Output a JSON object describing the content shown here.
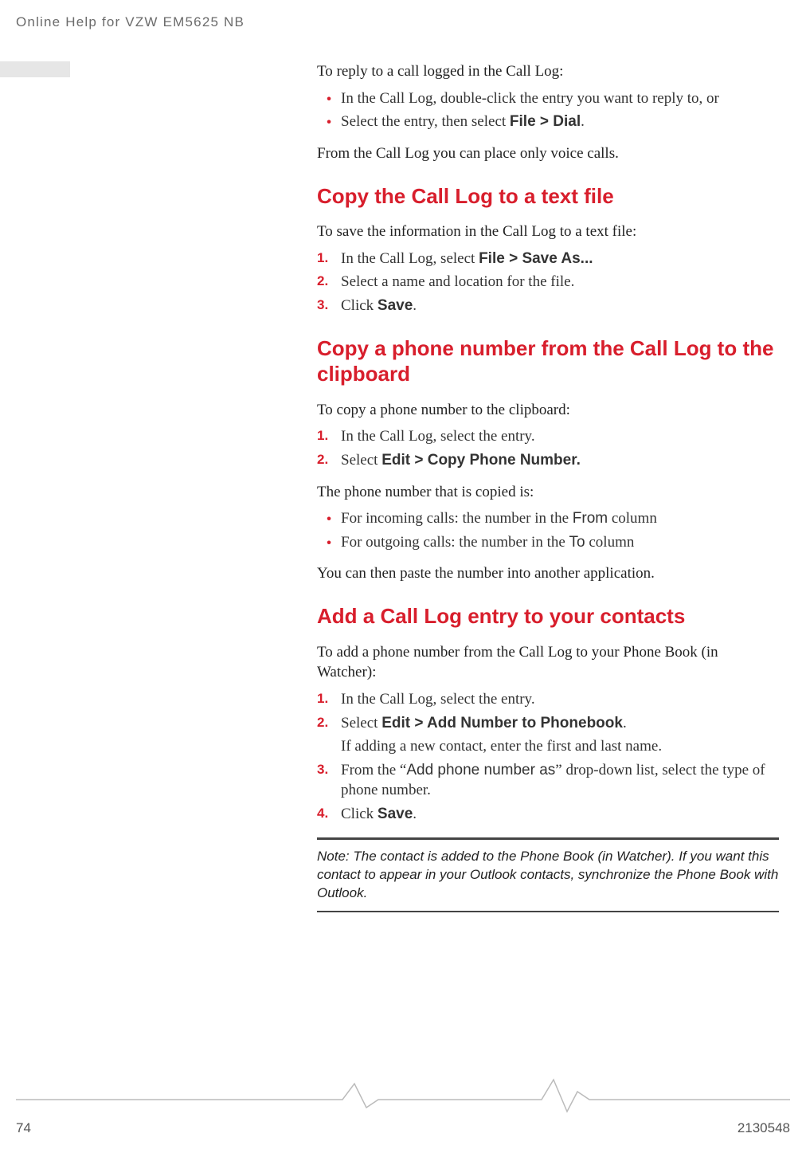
{
  "header": "Online Help for VZW EM5625 NB",
  "intro": {
    "lead": "To reply to a call logged in the Call Log:",
    "bullets": [
      {
        "pre": "In the Call Log, double-click the entry you want to reply to, or"
      },
      {
        "pre": "Select the entry, then select ",
        "bold": "File > Dial",
        "post": "."
      }
    ],
    "after": "From the Call Log you can place only voice calls."
  },
  "sec1": {
    "title": "Copy the Call Log to a text file",
    "lead": "To save the information in the Call Log to a text file:",
    "steps": [
      {
        "n": "1.",
        "pre": "In the Call Log, select ",
        "bold": "File > Save As...",
        "post": ""
      },
      {
        "n": "2.",
        "pre": "Select a name and location for the file.",
        "bold": "",
        "post": ""
      },
      {
        "n": "3.",
        "pre": "Click ",
        "bold": "Save",
        "post": "."
      }
    ]
  },
  "sec2": {
    "title": "Copy a phone number from the Call Log to the clipboard",
    "lead": "To copy a phone number to the clipboard:",
    "steps": [
      {
        "n": "1.",
        "pre": "In the Call Log, select the entry.",
        "bold": "",
        "post": ""
      },
      {
        "n": "2.",
        "pre": "Select ",
        "bold": "Edit > Copy Phone Number.",
        "post": ""
      }
    ],
    "mid": "The phone number that is copied is:",
    "bullets": [
      {
        "pre": "For incoming calls: the number in the ",
        "ui": "From",
        "post": " column"
      },
      {
        "pre": "For outgoing calls: the number in the ",
        "ui": "To",
        "post": " column"
      }
    ],
    "after": "You can then paste the number into another application."
  },
  "sec3": {
    "title": "Add a Call Log entry to your contacts",
    "lead": "To add a phone number from the Call Log to your Phone Book (in Watcher):",
    "steps": [
      {
        "n": "1.",
        "pre": "In the Call Log, select the entry.",
        "bold": "",
        "post": "",
        "extra": ""
      },
      {
        "n": "2.",
        "pre": "Select ",
        "bold": "Edit > Add Number to Phonebook",
        "post": ".",
        "extra": "If adding a new contact, enter the first and last name."
      },
      {
        "n": "3.",
        "pre": "From the “",
        "ui": "Add phone number as",
        "post": "” drop-down list, select the type of phone number.",
        "bold": "",
        "extra": ""
      },
      {
        "n": "4.",
        "pre": "Click ",
        "bold": "Save",
        "post": ".",
        "extra": ""
      }
    ]
  },
  "note": "Note:  The contact is added to the Phone Book (in Watcher). If you want this contact to appear in your Outlook contacts, synchronize the Phone Book with Outlook.",
  "footer": {
    "left": "74",
    "right": "2130548"
  }
}
